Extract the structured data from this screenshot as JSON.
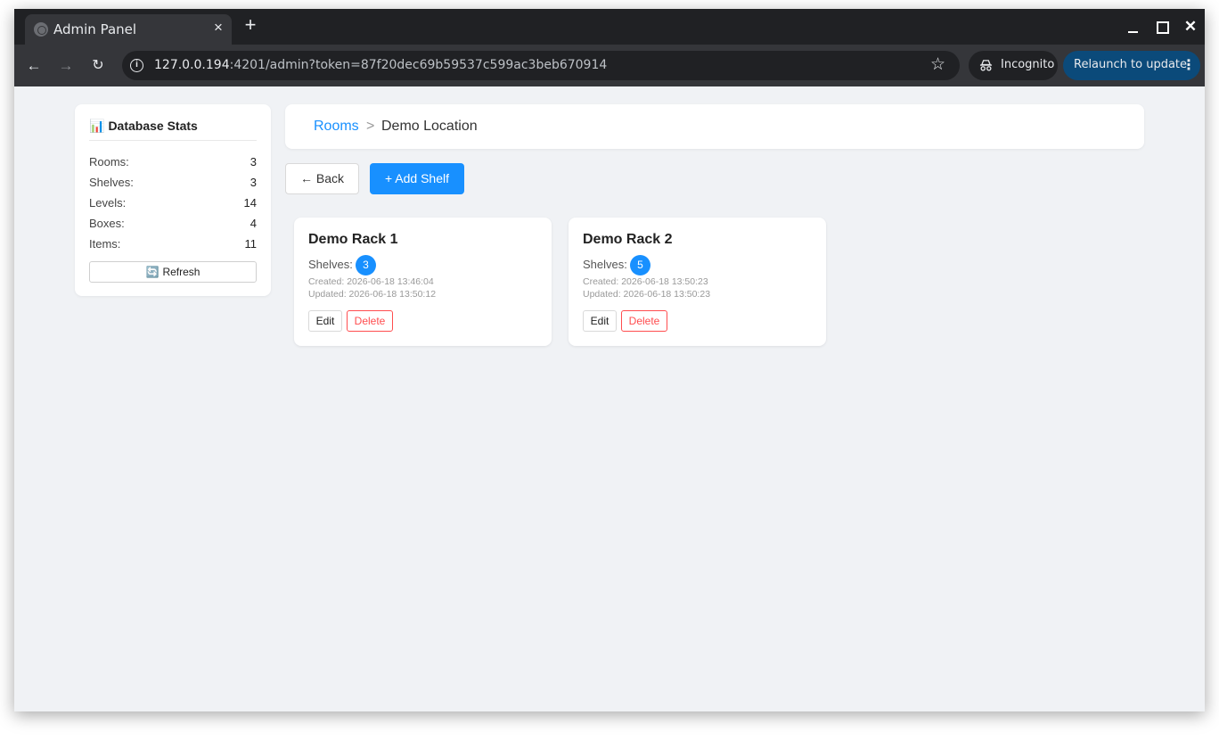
{
  "browser": {
    "tab_title": "Admin Panel",
    "tab_close": "×",
    "new_tab": "+",
    "url_host": "127.0.0.194",
    "url_rest": ":4201/admin?token=87f20dec69b59537c599ac3beb670914",
    "incognito_label": "Incognito",
    "relaunch_label": "Relaunch to update",
    "icons": [
      "globe-icon",
      "back-arrow-icon",
      "forward-arrow-icon",
      "reload-icon",
      "info-icon",
      "star-icon",
      "incognito-icon",
      "kebab-icon"
    ]
  },
  "stats": {
    "icon": "📊",
    "title": "Database Stats",
    "rows": [
      {
        "label": "Rooms:",
        "value": "3"
      },
      {
        "label": "Shelves:",
        "value": "3"
      },
      {
        "label": "Levels:",
        "value": "14"
      },
      {
        "label": "Boxes:",
        "value": "4"
      },
      {
        "label": "Items:",
        "value": "11"
      }
    ],
    "refresh_icon": "🔄",
    "refresh_label": "Refresh"
  },
  "breadcrumb": {
    "rooms": "Rooms",
    "separator": ">",
    "current": "Demo Location"
  },
  "actions": {
    "back_label": "← Back",
    "add_label": "+ Add Shelf"
  },
  "cards": [
    {
      "title": "Demo Rack 1",
      "shelves_label": "Shelves:",
      "shelves_count": "3",
      "created": "Created: 2026-06-18 13:46:04",
      "updated": "Updated: 2026-06-18 13:50:12",
      "edit_label": "Edit",
      "delete_label": "Delete"
    },
    {
      "title": "Demo Rack 2",
      "shelves_label": "Shelves:",
      "shelves_count": "5",
      "created": "Created: 2026-06-18 13:50:23",
      "updated": "Updated: 2026-06-18 13:50:23",
      "edit_label": "Edit",
      "delete_label": "Delete"
    }
  ],
  "colors": {
    "accent": "#1890ff",
    "danger": "#ff4d4f",
    "page_bg": "#f0f2f5"
  }
}
